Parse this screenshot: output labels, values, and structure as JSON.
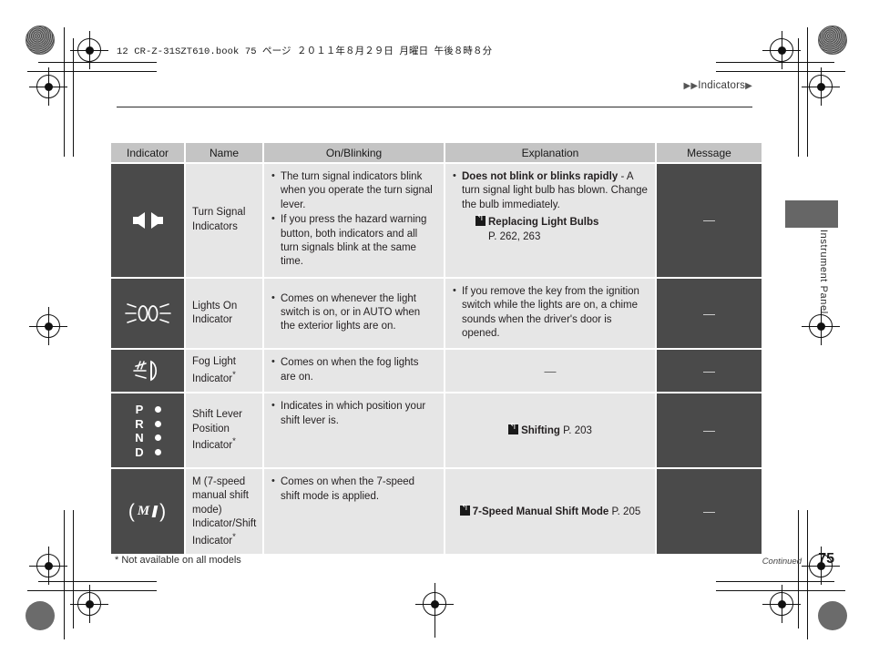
{
  "print_marks": {
    "book_line": "12 CR-Z-31SZT610.book  75 ページ  ２０１１年８月２９日  月曜日  午後８時８分"
  },
  "running_head": {
    "left_triangles": "▶▶",
    "text": "Indicators",
    "right_triangle": "▶"
  },
  "thumb_tab": {
    "label": "Instrument Panel"
  },
  "table": {
    "headers": [
      "Indicator",
      "Name",
      "On/Blinking",
      "Explanation",
      "Message"
    ],
    "rows": [
      {
        "icon": "turn-signal-arrows-icon",
        "name": "Turn Signal Indicators",
        "on_blinking": [
          "The turn signal indicators blink when you operate the turn signal lever.",
          "If you press the hazard warning button, both indicators and all turn signals blink at the same time."
        ],
        "explanation": {
          "bullets": [
            {
              "bold": "Does not blink or blinks rapidly",
              "rest": " - A turn signal light bulb has blown. Change the bulb immediately."
            }
          ],
          "reference": {
            "title": "Replacing Light Bulbs",
            "page": "P. 262, 263"
          }
        },
        "message": "—"
      },
      {
        "icon": "lights-on-icon",
        "name": "Lights On Indicator",
        "on_blinking": [
          "Comes on whenever the light switch is on, or in AUTO when the exterior lights are on."
        ],
        "explanation": {
          "bullets": [
            {
              "bold": "",
              "rest": "If you remove the key from the ignition switch while the lights are on, a chime sounds when the driver's door is opened."
            }
          ]
        },
        "message": "—"
      },
      {
        "icon": "fog-light-icon",
        "name": "Fog Light Indicator",
        "name_asterisk": "*",
        "on_blinking": [
          "Comes on when the fog lights are on."
        ],
        "explanation": {
          "dash": "—"
        },
        "message": "—"
      },
      {
        "icon": "shift-position-prnd-icon",
        "name": "Shift Lever Position Indicator",
        "name_asterisk": "*",
        "on_blinking": [
          "Indicates in which position your shift lever is."
        ],
        "explanation": {
          "reference_center": {
            "title": "Shifting",
            "page": "P. 203"
          }
        },
        "message": "—"
      },
      {
        "icon": "manual-shift-mode-m-icon",
        "name": "M (7-speed manual shift mode) Indicator/Shift Indicator",
        "name_asterisk": "*",
        "on_blinking": [
          "Comes on when the 7-speed shift mode is applied."
        ],
        "explanation": {
          "reference_center": {
            "title": "7-Speed Manual Shift Mode",
            "page": "P. 205"
          }
        },
        "message": "—"
      }
    ]
  },
  "footer": {
    "footnote": "* Not available on all models",
    "continued": "Continued",
    "page_number": "75"
  },
  "colors": {
    "header_fill": "#c4c4c4",
    "cell_fill": "#e6e6e6",
    "dark_fill": "#4a4a4a",
    "tab_fill": "#666666",
    "text": "#231f20"
  }
}
